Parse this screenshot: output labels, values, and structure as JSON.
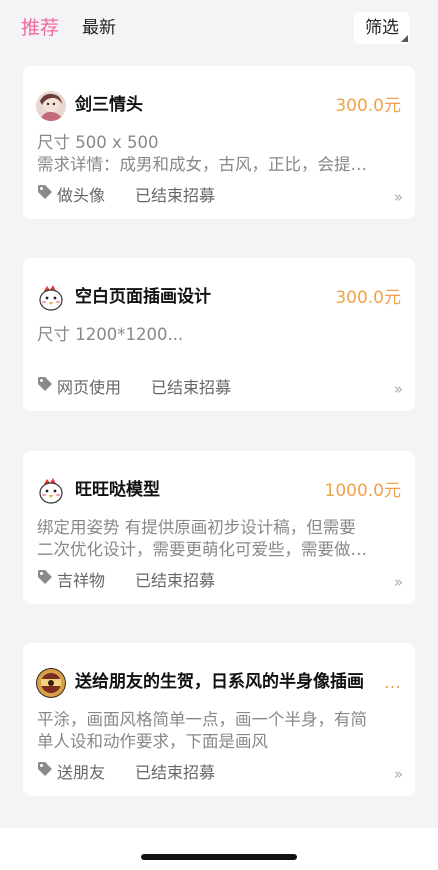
{
  "tabs": {
    "recommend": "推荐",
    "latest": "最新",
    "filter": "筛选"
  },
  "colors": {
    "accent_tab": "#ee6aa0",
    "price": "#f0a24a",
    "background": "#f4f4f6"
  },
  "cards": [
    {
      "avatar": "character-portrait-avatar",
      "title": "剑三情头",
      "price": "300.0元",
      "desc_lines": [
        "尺寸 500 x 500",
        "需求详情：成男和成女，古风，正比，会提…"
      ],
      "tag_icon": "tag-icon",
      "tag": "做头像",
      "status": "已结束招募",
      "chevron": "»"
    },
    {
      "avatar": "cartoon-chicken-avatar",
      "title": "空白页面插画设计",
      "price": "300.0元",
      "desc_lines": [
        "尺寸 1200*1200..."
      ],
      "tag_icon": "tag-icon",
      "tag": "网页使用",
      "status": "已结束招募",
      "chevron": "»"
    },
    {
      "avatar": "cartoon-chicken-avatar",
      "title": "旺旺哒模型",
      "price": "1000.0元",
      "desc_lines": [
        "绑定用姿势 有提供原画初步设计稿，但需要",
        "二次优化设计，需要更萌化可爱些，需要做…"
      ],
      "tag_icon": "tag-icon",
      "tag": "吉祥物",
      "status": "已结束招募",
      "chevron": "»"
    },
    {
      "avatar": "cameo-badge-avatar",
      "title": "送给朋友的生贺，日系风的半身像插画",
      "price": "…",
      "desc_lines": [
        "平涂，画面风格简单一点，画一个半身，有简",
        "单人设和动作要求，下面是画风"
      ],
      "tag_icon": "tag-icon",
      "tag": "送朋友",
      "status": "已结束招募",
      "chevron": "»"
    }
  ]
}
